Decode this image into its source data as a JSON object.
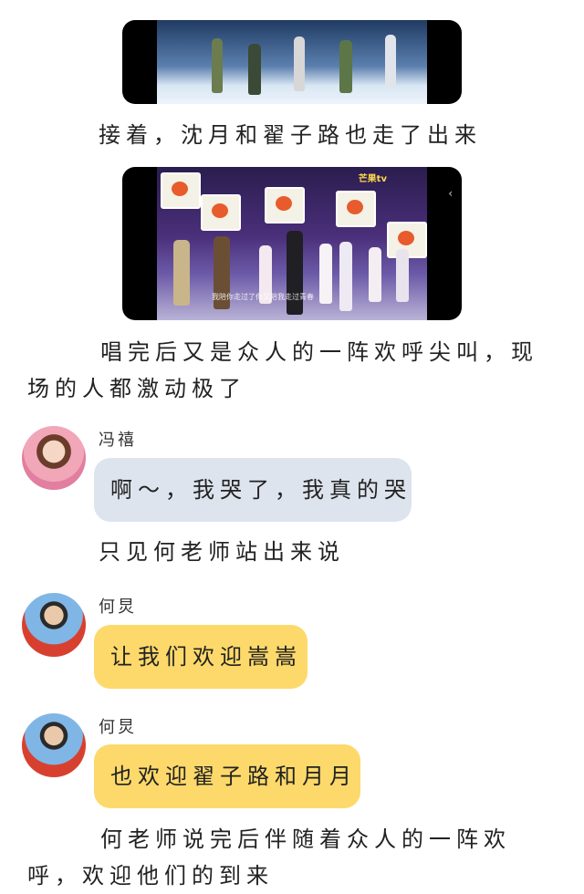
{
  "videos": [
    {
      "kind": "stage-dance-clip"
    },
    {
      "kind": "stage-performance-clip",
      "watermark": "芒果tv",
      "subtitle": "我陪你走过了你又陪我走过青春"
    }
  ],
  "narration": [
    "接着，沈月和翟子路也走了出来",
    "唱完后又是众人的一阵欢呼尖叫，现场的人都激动极了",
    "只见何老师站出来说",
    "何老师说完后伴随着众人的一阵欢呼，欢迎他们的到来"
  ],
  "messages": [
    {
      "sender": "冯禧",
      "text": "啊～，我哭了，我真的哭",
      "bubble_color": "#dde4ed"
    },
    {
      "sender": "何炅",
      "text": "让我们欢迎嵩嵩",
      "bubble_color": "#fcd96a"
    },
    {
      "sender": "何炅",
      "text": "也欢迎翟子路和月月",
      "bubble_color": "#fcd96a"
    }
  ]
}
